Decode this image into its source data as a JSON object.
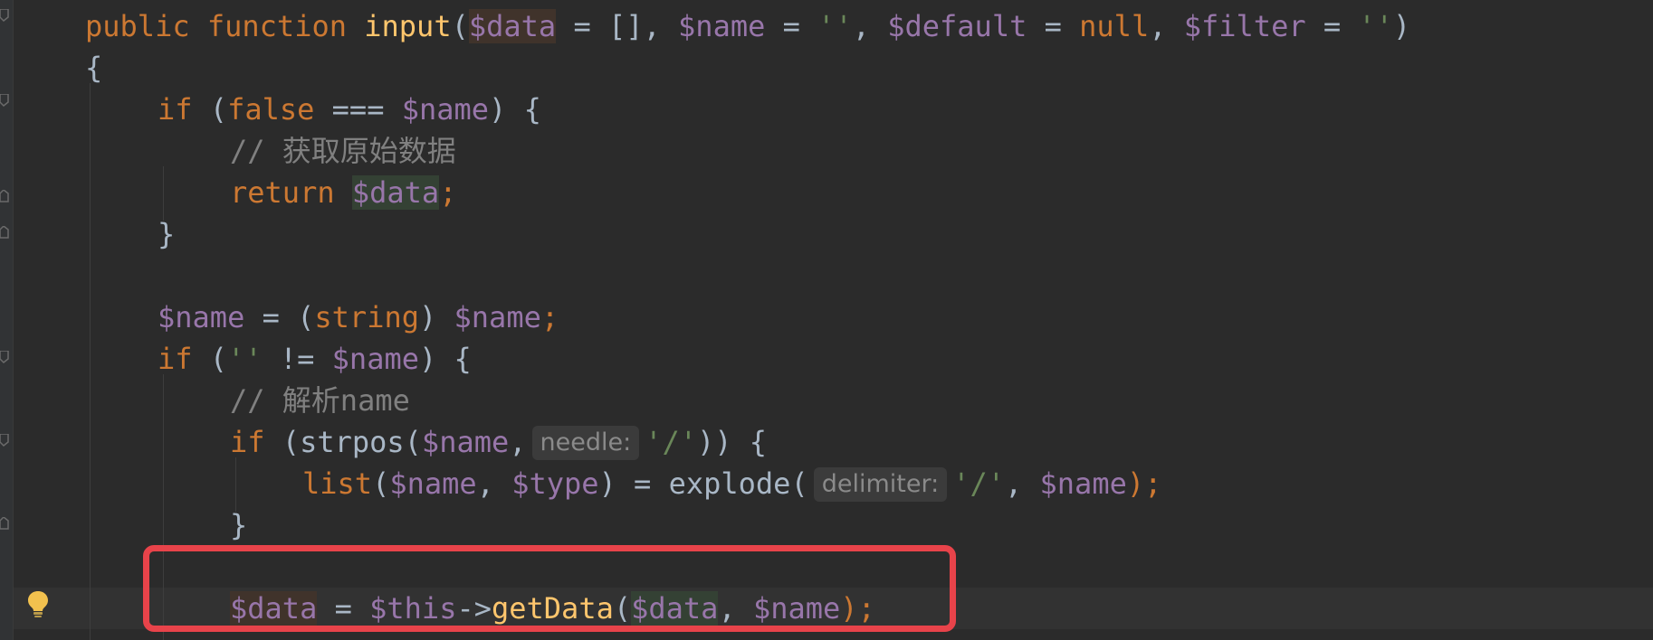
{
  "editor": {
    "lines": {
      "l1": {
        "kw1": "public",
        "kw2": "function",
        "fname": "input",
        "p1": "(",
        "v1": "$data",
        "p2": " = [], ",
        "v2": "$name",
        "p3": " = ",
        "s1": "''",
        "p4": ", ",
        "v3": "$default",
        "p5": " = ",
        "kw3": "null",
        "p6": ", ",
        "v4": "$filter",
        "p7": " = ",
        "s2": "''",
        "p8": ")"
      },
      "l2": {
        "p1": "{"
      },
      "l3": {
        "kw1": "if",
        "p1": " (",
        "kw2": "false",
        "p2": " === ",
        "v1": "$name",
        "p3": ") {"
      },
      "l4": {
        "c1": "// 获取原始数据"
      },
      "l5": {
        "kw1": "return",
        "p1": " ",
        "v1": "$data",
        "p2": ";"
      },
      "l6": {
        "p1": "}"
      },
      "l7": {
        "v1": "$name",
        "p1": " = (",
        "kw1": "string",
        "p2": ") ",
        "v2": "$name",
        "p3": ";"
      },
      "l8": {
        "kw1": "if",
        "p1": " (",
        "s1": "''",
        "p2": " != ",
        "v1": "$name",
        "p3": ") {"
      },
      "l9": {
        "c1": "// 解析name"
      },
      "l10": {
        "kw1": "if",
        "p1": " (strpos(",
        "v1": "$name",
        "p2": ",",
        "hint": "needle:",
        "s1": "'/'",
        "p3": ")) {"
      },
      "l11": {
        "f1": "list",
        "p1": "(",
        "v1": "$name",
        "p2": ", ",
        "v2": "$type",
        "p3": ") = explode(",
        "hint": "delimiter:",
        "s1": "'/'",
        "p4": ", ",
        "v3": "$name",
        "p5": ");"
      },
      "l12": {
        "p1": "}"
      },
      "l13": {
        "v1": "$data",
        "p1": " = ",
        "v2": "$this",
        "p2": "->",
        "fn1": "getData",
        "p3": "(",
        "v3": "$data",
        "p4": ", ",
        "v4": "$name",
        "p5": ");"
      }
    }
  },
  "colors": {
    "background": "#2b2b2b",
    "keyword": "#cc7832",
    "function": "#ffc66d",
    "variable": "#9876aa",
    "string": "#6a8759",
    "comment": "#808080",
    "highlight_box": "#e8434a"
  },
  "icons": {
    "gutter_action": "lightbulb-icon",
    "fold_marker": "fold-marker-icon"
  }
}
